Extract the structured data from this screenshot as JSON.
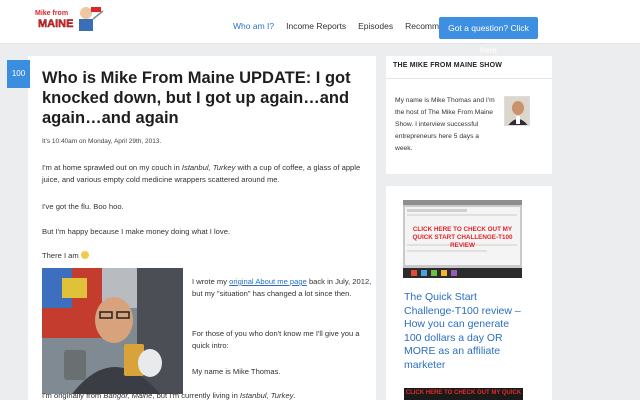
{
  "header": {
    "logo_text_line1": "Mike from",
    "logo_text_line2": "MAINE",
    "nav": [
      {
        "label": "Who am I?",
        "active": true
      },
      {
        "label": "Income Reports",
        "active": false
      },
      {
        "label": "Episodes",
        "active": false
      },
      {
        "label": "Recommended",
        "active": false
      }
    ],
    "cta_label": "Got a question? Click here"
  },
  "post": {
    "badge": "100",
    "title": "Who is Mike From Maine UPDATE: I got knocked down, but I got up again…and again…and again",
    "date": "It's 10:40am on Monday, April 29th, 2013.",
    "p1_a": "I'm at home sprawled out on my couch in ",
    "p1_city": "Istanbul, Turkey",
    "p1_b": " with a cup of coffee, a glass of apple juice, and various empty cold medicine wrappers scattered around me.",
    "p2": "I've got the flu. Boo hoo.",
    "p3": "But I'm happy because I make money doing what I love.",
    "p4": "There I am",
    "p5_a": "I wrote my ",
    "p5_link": "original About me page",
    "p5_b": " back in July, 2012, but my \"situation\" has changed a lot since then.",
    "p6": "For those of you who don't know me I'll give you a quick intro:",
    "p7": "My name is Mike Thomas.",
    "p8_a": "I'm originally from ",
    "p8_place1": "Bangor, Maine",
    "p8_b": ", but I'm currently living in ",
    "p8_place2": "Istanbul, Turkey",
    "p8_c": "."
  },
  "sidebar": {
    "show_title": "THE MIKE FROM MAINE SHOW",
    "show_text": "My name is Mike Thomas and I'm the host of The Mike From Maine Show. I interview successful entrepreneurs here 5 days a week.",
    "review_thumb_text": "CLICK HERE TO CHECK OUT MY QUICK START CHALLENGE-T100 REVIEW",
    "review_title": "The Quick Start Challenge-T100 review – How you can generate 100 dollars a day OR MORE as an affiliate marketer",
    "second_thumb_text": "CLICK HERE TO CHECK OUT MY QUICK"
  },
  "colors": {
    "accent": "#3b8de0",
    "link": "#2a6fc0",
    "background": "#ecedee"
  }
}
